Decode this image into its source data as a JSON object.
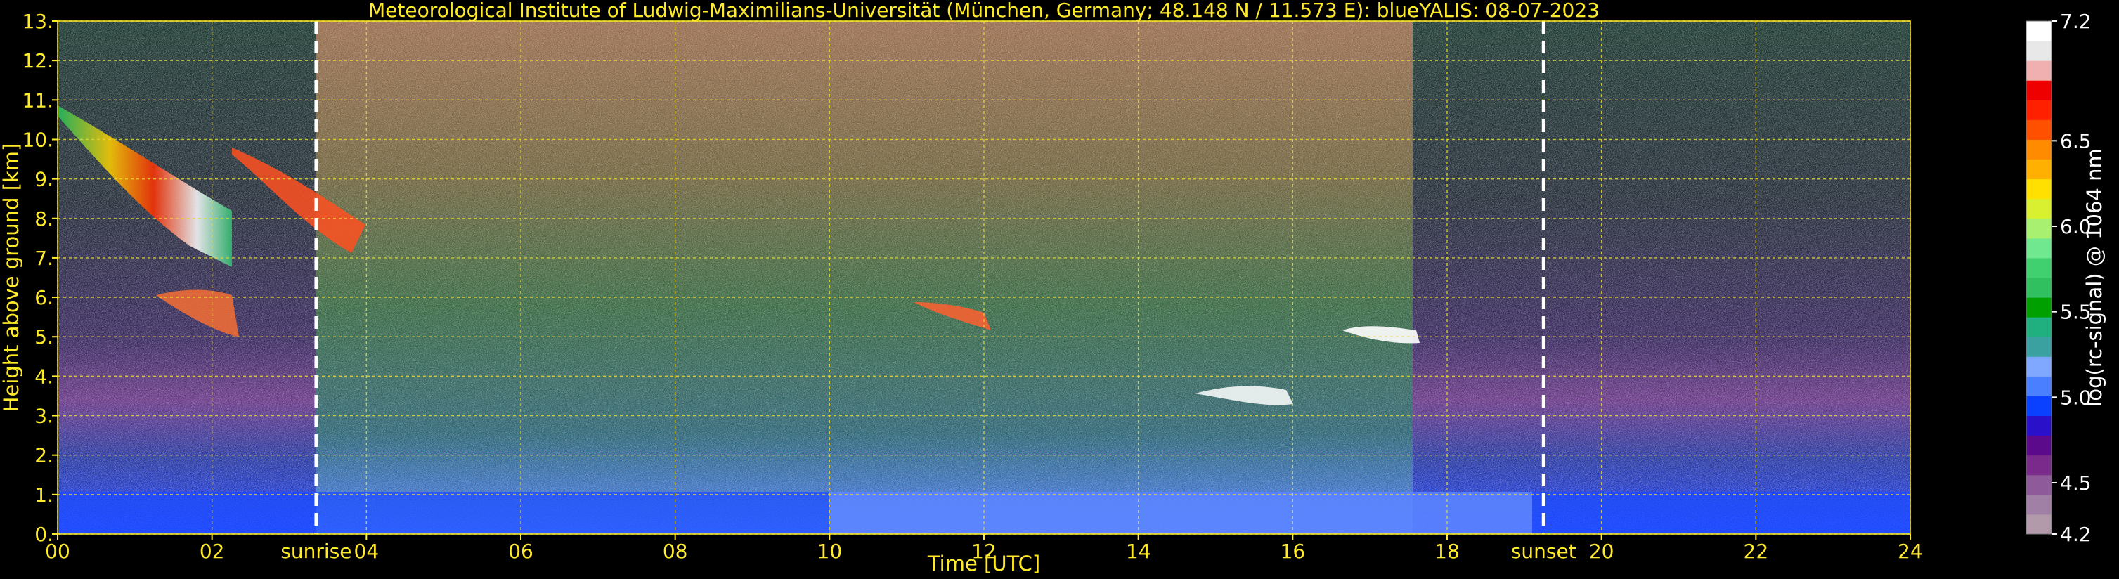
{
  "chart_data": {
    "type": "heatmap",
    "title": "Meteorological Institute of Ludwig-Maximilians-Universität (München, Germany; 48.148 N / 11.573 E):    blueYALIS: 08-07-2023",
    "xlabel": "Time [UTC]",
    "ylabel": "Height above ground [km]",
    "xlim": [
      0,
      24
    ],
    "ylim": [
      0,
      13
    ],
    "x_ticks": [
      0,
      2,
      4,
      6,
      8,
      10,
      12,
      14,
      16,
      18,
      20,
      22,
      24
    ],
    "x_tick_labels": [
      "00",
      "02",
      "04",
      "06",
      "08",
      "10",
      "12",
      "14",
      "16",
      "18",
      "20",
      "22",
      "24"
    ],
    "y_ticks": [
      0,
      1,
      2,
      3,
      4,
      5,
      6,
      7,
      8,
      9,
      10,
      11,
      12,
      13
    ],
    "y_tick_labels": [
      "0.",
      "1.",
      "2.",
      "3.",
      "4.",
      "5.",
      "6.",
      "7.",
      "8.",
      "9.",
      "10.",
      "11.",
      "12.",
      "13."
    ],
    "grid": true,
    "events": [
      {
        "label": "sunrise",
        "x": 3.35
      },
      {
        "label": "sunset",
        "x": 19.25
      }
    ],
    "colorbar": {
      "label": "log(rc-signal) @ 1064 nm",
      "range": [
        4.2,
        7.2
      ],
      "ticks": [
        4.2,
        4.5,
        5.0,
        5.5,
        6.0,
        6.5,
        7.2
      ],
      "tick_labels": [
        "4.2",
        "4.5",
        "5.0",
        "5.5",
        "6.0",
        "6.5",
        "7.2"
      ],
      "colors": [
        "#b39aab",
        "#a080a4",
        "#8f5a9a",
        "#7a2a8a",
        "#5a0a8a",
        "#2a10c8",
        "#0a40ff",
        "#4a80ff",
        "#80a8ff",
        "#3aa0a0",
        "#20b080",
        "#00a000",
        "#30c060",
        "#40d070",
        "#70e890",
        "#a8f070",
        "#d8f030",
        "#ffe000",
        "#ffb000",
        "#ff8c00",
        "#ff5000",
        "#ff2000",
        "#ee0000",
        "#f0b0b0",
        "#e8e8e8",
        "#ffffff"
      ]
    }
  }
}
